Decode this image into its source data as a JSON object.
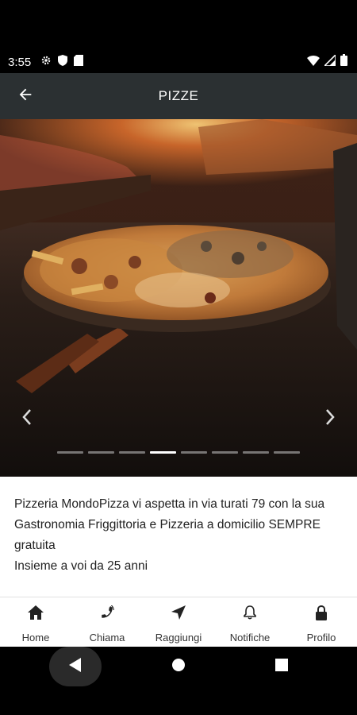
{
  "status_bar": {
    "time": "3:55",
    "left_icons": [
      "settings-icon",
      "shield-icon",
      "sd-card-icon"
    ],
    "right_icons": [
      "wifi-icon",
      "signal-icon",
      "battery-icon"
    ]
  },
  "app_bar": {
    "title": "PIZZE",
    "back_icon": "arrow-left-icon"
  },
  "carousel": {
    "total_slides": 8,
    "active_index": 3,
    "image_description": "pizza in wood-fired oven"
  },
  "description": {
    "text": "Pizzeria MondoPizza vi aspetta in via turati 79 con la sua Gastronomia Friggittoria e Pizzeria a domicilio SEMPRE gratuita\nInsieme a voi da 25 anni"
  },
  "bottom_nav": {
    "items": [
      {
        "label": "Home",
        "icon": "home-icon"
      },
      {
        "label": "Chiama",
        "icon": "phone-icon"
      },
      {
        "label": "Raggiungi",
        "icon": "navigation-icon"
      },
      {
        "label": "Notifiche",
        "icon": "bell-icon"
      },
      {
        "label": "Profilo",
        "icon": "lock-icon"
      }
    ]
  },
  "colors": {
    "app_bar": "#2b3032",
    "status_bar": "#000000",
    "text": "#222222"
  }
}
